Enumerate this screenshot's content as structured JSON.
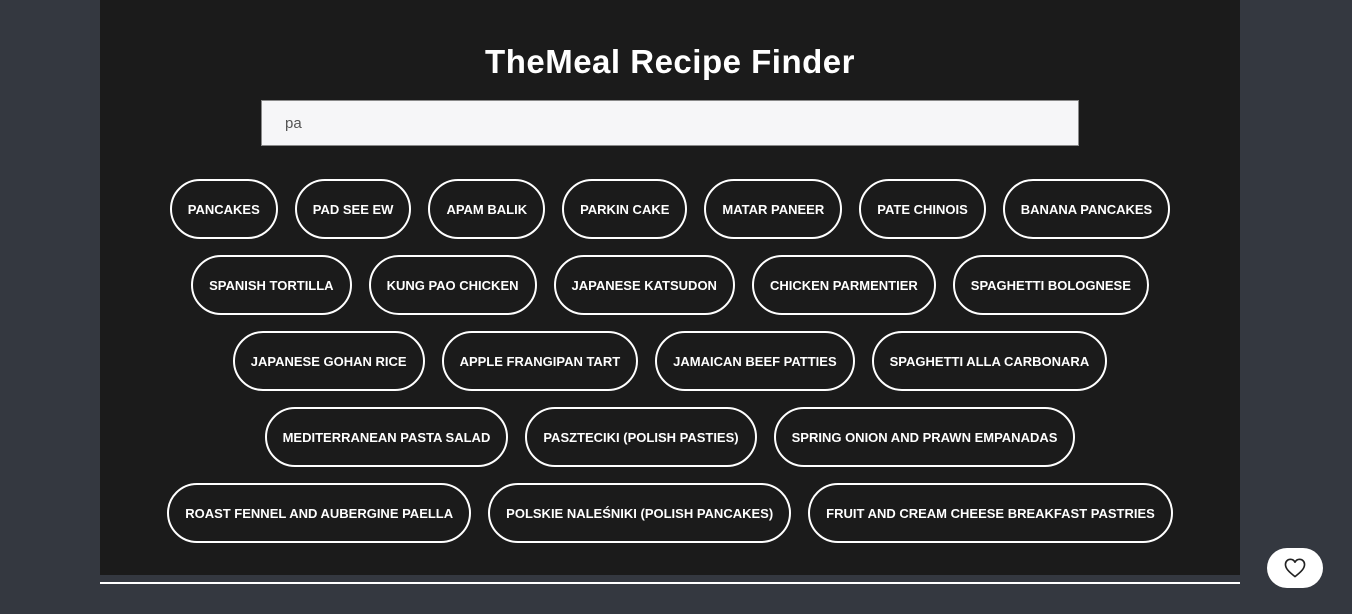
{
  "app": {
    "title": "TheMeal Recipe Finder"
  },
  "search": {
    "value": "pa"
  },
  "meal_rows": [
    [
      "PANCAKES",
      "PAD SEE EW",
      "APAM BALIK",
      "PARKIN CAKE",
      "MATAR PANEER",
      "PATE CHINOIS",
      "BANANA PANCAKES"
    ],
    [
      "SPANISH TORTILLA",
      "KUNG PAO CHICKEN",
      "JAPANESE KATSUDON",
      "CHICKEN PARMENTIER",
      "SPAGHETTI BOLOGNESE"
    ],
    [
      "JAPANESE GOHAN RICE",
      "APPLE FRANGIPAN TART",
      "JAMAICAN BEEF PATTIES",
      "SPAGHETTI ALLA CARBONARA"
    ],
    [
      "MEDITERRANEAN PASTA SALAD",
      "PASZTECIKI (POLISH PASTIES)",
      "SPRING ONION AND PRAWN EMPANADAS"
    ],
    [
      "ROAST FENNEL AND AUBERGINE PAELLA",
      "POLSKIE NALEŚNIKI (POLISH PANCAKES)",
      "FRUIT AND CREAM CHEESE BREAKFAST PASTRIES"
    ]
  ],
  "favorites_button": {
    "icon": "heart-icon"
  },
  "colors": {
    "page_bg": "#343840",
    "panel_bg": "#1b1b1b",
    "accent": "#ffffff"
  }
}
